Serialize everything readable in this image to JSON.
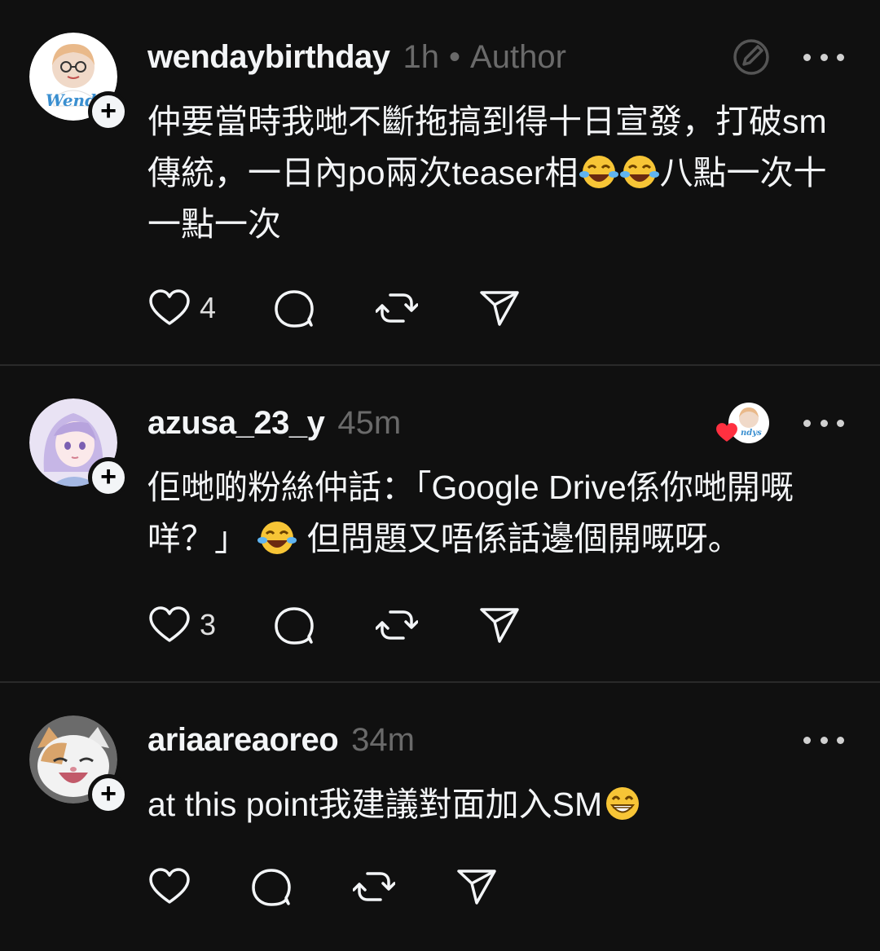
{
  "posts": [
    {
      "username": "wendaybirthday",
      "time": "1h",
      "author_tag": "Author",
      "avatar_text": "Wend",
      "follow_symbol": "+",
      "text_parts": [
        "仲要當時我哋不斷拖搞到得十日宣發，打破sm傳統，一日內po兩次teaser相",
        "八點一次十一點一次"
      ],
      "emojis": [
        "tears-of-joy-emoji",
        "tears-of-joy-emoji"
      ],
      "likes": "4"
    },
    {
      "username": "azusa_23_y",
      "time": "45m",
      "follow_symbol": "+",
      "liked_by_author_badge_text": "ndys",
      "text_parts": [
        "佢哋啲粉絲仲話：「Google Drive係你哋開嘅咩？」",
        " 但問題又唔係話邊個開嘅呀。"
      ],
      "emojis": [
        "tears-of-joy-emoji"
      ],
      "likes": "3"
    },
    {
      "username": "ariaareaoreo",
      "time": "34m",
      "follow_symbol": "+",
      "text_parts": [
        "at this point我建議對面加入SM"
      ],
      "emojis": [
        "grinning-emoji"
      ],
      "likes": ""
    }
  ],
  "colors": {
    "background": "#101010",
    "text": "#f3f5f7",
    "secondary": "#6a6a6a",
    "divider": "#2a2a2a",
    "heart": "#ff3040"
  }
}
